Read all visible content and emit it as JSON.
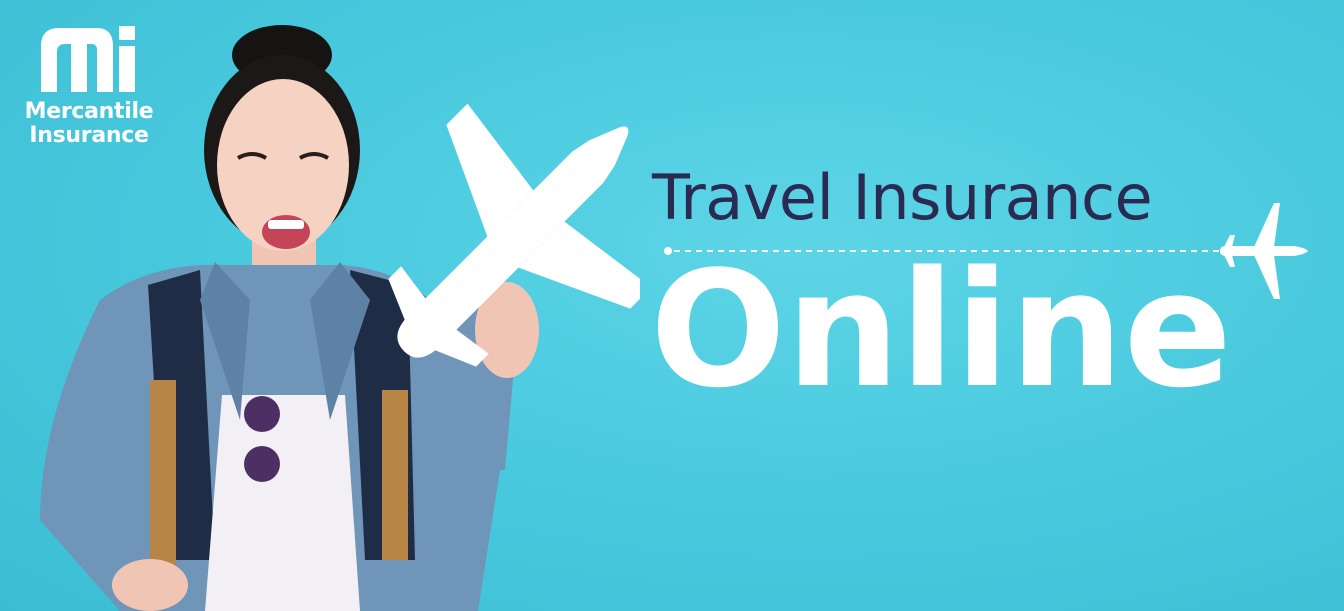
{
  "brand": {
    "name_line1": "Mercantile",
    "name_line2": "Insurance"
  },
  "headline": {
    "line1": "Travel Insurance",
    "line2": "Online"
  },
  "colors": {
    "background": "#47c8dd",
    "headline_dark": "#2b2a52",
    "white": "#ffffff"
  },
  "icons": [
    "mercantile-logo-icon",
    "paper-airplane-cutout-icon",
    "airplane-icon"
  ]
}
